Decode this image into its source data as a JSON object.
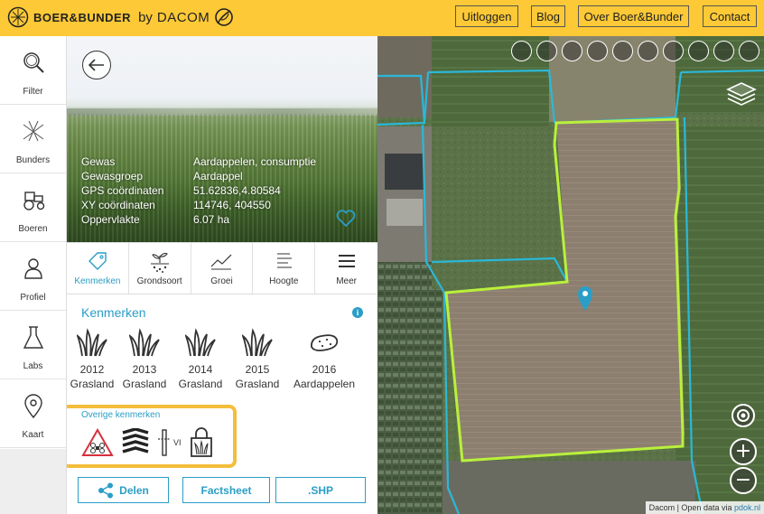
{
  "header": {
    "logo_text": "BOER&BUNDER",
    "logo_by": "by",
    "logo_dacom": "DACOM",
    "nav": [
      "Uitloggen",
      "Blog",
      "Over Boer&Bunder",
      "Contact"
    ]
  },
  "sidebar": {
    "items": [
      {
        "label": "Filter",
        "icon": "magnifier-icon"
      },
      {
        "label": "Bunders",
        "icon": "bunders-icon"
      },
      {
        "label": "Boeren",
        "icon": "tractor-icon"
      },
      {
        "label": "Profiel",
        "icon": "person-icon"
      },
      {
        "label": "Labs",
        "icon": "flask-icon"
      },
      {
        "label": "Kaart",
        "icon": "map-pin-icon"
      }
    ]
  },
  "field": {
    "rows": [
      {
        "key": "Gewas",
        "value": "Aardappelen, consumptie"
      },
      {
        "key": "Gewasgroep",
        "value": "Aardappel"
      },
      {
        "key": "GPS coördinaten",
        "value": "51.62836,4.80584"
      },
      {
        "key": "XY coördinaten",
        "value": "114746, 404550"
      },
      {
        "key": "Oppervlakte",
        "value": "6.07 ha"
      }
    ]
  },
  "tabs": [
    {
      "label": "Kenmerken",
      "active": true
    },
    {
      "label": "Grondsoort",
      "active": false
    },
    {
      "label": "Groei",
      "active": false
    },
    {
      "label": "Hoogte",
      "active": false
    },
    {
      "label": "Meer",
      "active": false
    }
  ],
  "kenmerken": {
    "title": "Kenmerken",
    "info": "i",
    "years": [
      {
        "year": "2012",
        "crop": "Grasland",
        "icon": "grass-icon"
      },
      {
        "year": "2013",
        "crop": "Grasland",
        "icon": "grass-icon"
      },
      {
        "year": "2014",
        "crop": "Grasland",
        "icon": "grass-icon"
      },
      {
        "year": "2015",
        "crop": "Grasland",
        "icon": "grass-icon"
      },
      {
        "year": "2016",
        "crop": "Aardappelen",
        "icon": "potato-icon"
      }
    ],
    "overige_title": "Overige kenmerken",
    "vi_label": "VI"
  },
  "actions": [
    "Delen",
    "Factsheet",
    ".SHP"
  ],
  "map": {
    "attribution_prefix": "Dacom | Open data via ",
    "attribution_link": "pdok.nl",
    "zoom_in": "+",
    "zoom_out": "−",
    "field_border_color": "#b9f03c",
    "parcel_color": "#2bb8d8",
    "marker_color": "#2a9ec6"
  },
  "colors": {
    "brand_yellow": "#fdc936",
    "accent_blue": "#2a9ec6",
    "highlight_orange": "#f4bd3b"
  }
}
